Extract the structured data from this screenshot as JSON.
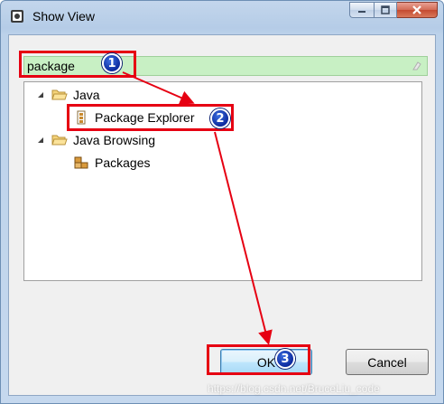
{
  "window": {
    "title": "Show View",
    "icon": "eclipse-view-icon",
    "caption_buttons": [
      "minimize-icon",
      "maximize-icon",
      "close-icon"
    ]
  },
  "filter": {
    "value": "package",
    "clear_icon": "eraser-icon"
  },
  "tree": {
    "nodes": [
      {
        "label": "Java",
        "icon": "folder-open-icon",
        "expanded": true,
        "children": [
          {
            "label": "Package Explorer",
            "icon": "package-explorer-icon"
          }
        ]
      },
      {
        "label": "Java Browsing",
        "icon": "folder-open-icon",
        "expanded": true,
        "children": [
          {
            "label": "Packages",
            "icon": "packages-icon"
          }
        ]
      }
    ]
  },
  "buttons": {
    "ok": "OK",
    "cancel": "Cancel"
  },
  "annotations": {
    "step1": "1",
    "step2": "2",
    "step3": "3",
    "color": "#e60012"
  },
  "watermark": "https://blog.csdn.net/BruceLiu_code"
}
